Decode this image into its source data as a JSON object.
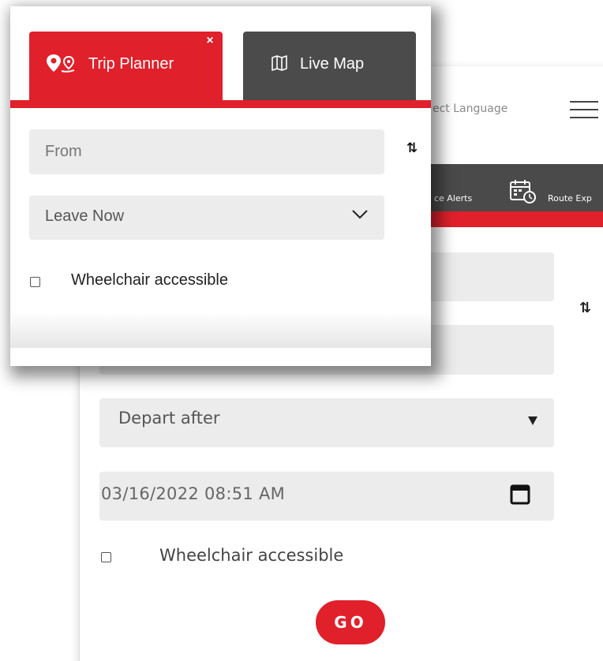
{
  "background_page": {
    "language_selector": "ect Language",
    "nav": {
      "alerts_label": "ce Alerts",
      "route_label": "Route Exp"
    },
    "swap_symbol": "⇅",
    "departure_select": "Depart after",
    "datetime_value": "03/16/2022 08:51 AM",
    "wheelchair_label": "Wheelchair accessible",
    "go_label": "GO"
  },
  "popup": {
    "tabs": [
      {
        "label": "Trip Planner",
        "active": true,
        "icon": "location-pin-icon"
      },
      {
        "label": "Live Map",
        "active": false,
        "icon": "map-icon"
      }
    ],
    "close_symbol": "×",
    "from_placeholder": "From",
    "swap_symbol": "⇅",
    "leave_select": "Leave Now",
    "wheelchair_label": "Wheelchair accessible"
  },
  "colors": {
    "brand_red": "#e0202b",
    "dark_tab": "#4b4b4b",
    "field_bg": "#ececec"
  }
}
